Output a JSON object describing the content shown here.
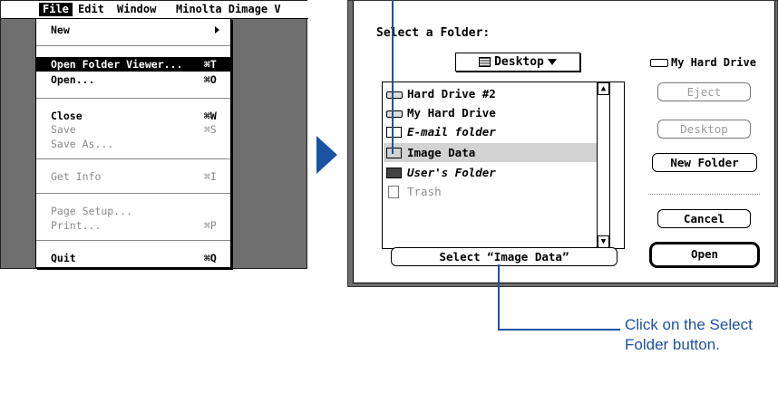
{
  "menubar": {
    "items": [
      "File",
      "Edit",
      "Window",
      "Minolta Dimage V"
    ]
  },
  "file_menu": {
    "items": [
      {
        "label": "New",
        "shortcut": "",
        "submenu": true,
        "disabled": false
      },
      {
        "label": "Open Folder Viewer...",
        "shortcut": "⌘T",
        "disabled": false,
        "selected": true
      },
      {
        "label": "Open...",
        "shortcut": "⌘O",
        "disabled": false
      },
      {
        "label": "Close",
        "shortcut": "⌘W",
        "disabled": false
      },
      {
        "label": "Save",
        "shortcut": "⌘S",
        "disabled": true
      },
      {
        "label": "Save As...",
        "shortcut": "",
        "disabled": true
      },
      {
        "label": "Get Info",
        "shortcut": "⌘I",
        "disabled": true
      },
      {
        "label": "Page Setup...",
        "shortcut": "",
        "disabled": true
      },
      {
        "label": "Print...",
        "shortcut": "⌘P",
        "disabled": true
      },
      {
        "label": "Quit",
        "shortcut": "⌘Q",
        "disabled": false
      }
    ]
  },
  "dialog": {
    "title": "Select a Folder:",
    "location_popup": "Desktop",
    "disk_name": "My Hard Drive",
    "files": [
      {
        "name": "Hard Drive #2",
        "icon": "drive-icon",
        "italic": false,
        "dim": false
      },
      {
        "name": "My Hard Drive",
        "icon": "drive-icon",
        "italic": false,
        "dim": false
      },
      {
        "name": "E-mail folder",
        "icon": "folder-icon",
        "italic": true,
        "dim": false
      },
      {
        "name": "Image Data",
        "icon": "folder-icon",
        "italic": false,
        "dim": false,
        "selected": true
      },
      {
        "name": "User's Folder",
        "icon": "folder-icon",
        "italic": true,
        "dim": false
      },
      {
        "name": "Trash",
        "icon": "trash-icon",
        "italic": false,
        "dim": true
      }
    ],
    "buttons": {
      "eject": "Eject",
      "desktop": "Desktop",
      "new_folder": "New Folder",
      "cancel": "Cancel",
      "open": "Open",
      "select": "Select “Image Data”"
    }
  },
  "callout": {
    "text": "Click on the Select Folder button."
  },
  "colors": {
    "accent_blue": "#1c52a3",
    "menu_bg": "#6e6e6e"
  }
}
